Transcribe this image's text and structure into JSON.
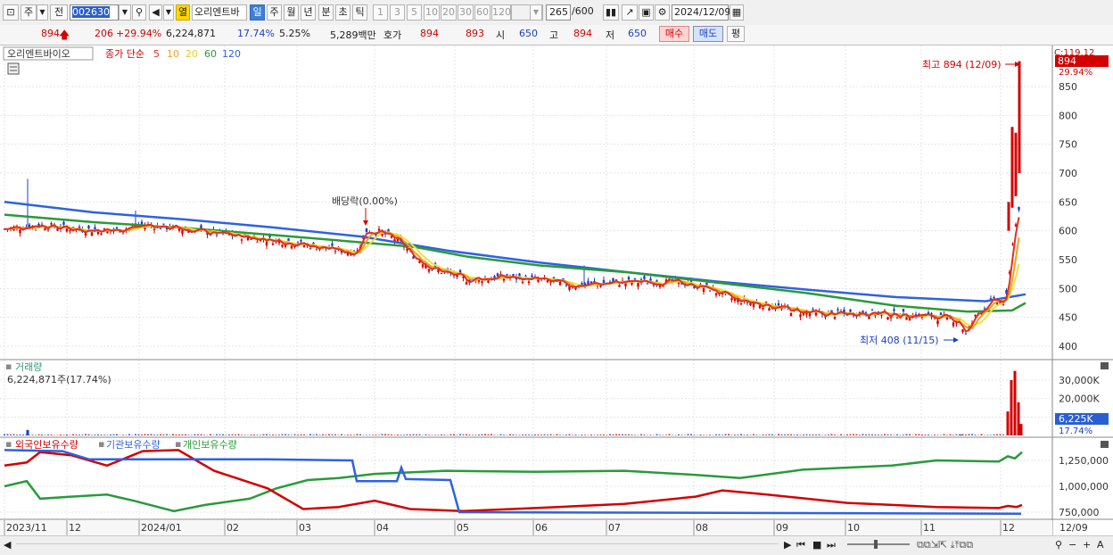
{
  "toolbar": {
    "type": "주",
    "prefix": "전",
    "code": "002630",
    "speaker_icon": "speaker-icon",
    "group_btn": "열",
    "name": "오리엔트바",
    "periods": [
      "일",
      "주",
      "월",
      "년",
      "분",
      "초",
      "틱"
    ],
    "active_period": "일",
    "minute_nums": [
      "1",
      "3",
      "5",
      "10",
      "20",
      "30",
      "60",
      "120"
    ],
    "count": "265",
    "count_total": "/600",
    "date": "2024/12/09"
  },
  "info": {
    "price": "894",
    "change": "206",
    "change_pct": "+29.94%",
    "volume": "6,224,871",
    "vol_pct": "17.74%",
    "turnover": "5.25%",
    "amount": "5,289백만",
    "quote_label": "호가",
    "ask": "894",
    "bid": "893",
    "open_label": "시",
    "open": "650",
    "high_label": "고",
    "high": "894",
    "low_label": "저",
    "low": "650",
    "buy": "매수",
    "sell": "매도",
    "eval": "평"
  },
  "price_pane": {
    "stock_label": "오리엔트바이오",
    "ma_label": "종가 단순",
    "ma_periods": [
      "5",
      "10",
      "20",
      "60",
      "120"
    ],
    "top_right": "C:119.12",
    "last_price": "894",
    "last_pct": "29.94%",
    "high_annot": "최고 894 (12/09)",
    "low_annot": "최저 408 (11/15)",
    "div_annot": "배당락(0.00%)",
    "y_ticks": [
      "850",
      "800",
      "750",
      "700",
      "650",
      "600",
      "550",
      "500",
      "450",
      "400"
    ]
  },
  "volume_pane": {
    "title": "거래량",
    "subtitle": "6,224,871주(17.74%)",
    "y_ticks": [
      "30,000K",
      "20,000K",
      "10,000K"
    ],
    "last": "6,225K",
    "last_pct": "17.74%"
  },
  "holding_pane": {
    "legend": [
      "외국인보유수량",
      "기관보유수량",
      "개인보유수량"
    ],
    "y_ticks": [
      "1,250,000",
      "1,000,000",
      "750,000"
    ]
  },
  "x_axis": {
    "labels": [
      "2023/11",
      "12",
      "2024/01",
      "02",
      "03",
      "04",
      "05",
      "06",
      "07",
      "08",
      "09",
      "10",
      "11",
      "12"
    ],
    "end_label": "12/09"
  },
  "colors": {
    "up": "#d40000",
    "down": "#1d3fc0",
    "ma5": "#e03020",
    "ma10": "#f0a020",
    "ma20": "#f0e040",
    "ma60": "#2a9a3a",
    "ma120": "#2e62e0"
  },
  "chart_data": {
    "type": "candlestick",
    "title": "오리엔트바이오",
    "x": [
      "2023/11",
      "12",
      "2024/01",
      "02",
      "03",
      "04",
      "05",
      "06",
      "07",
      "08",
      "09",
      "10",
      "11",
      "12"
    ],
    "close_path": [
      [
        0,
        603
      ],
      [
        40,
        610
      ],
      [
        80,
        603
      ],
      [
        120,
        600
      ],
      [
        160,
        610
      ],
      [
        200,
        603
      ],
      [
        240,
        595
      ],
      [
        280,
        588
      ],
      [
        320,
        580
      ],
      [
        360,
        570
      ],
      [
        395,
        562
      ],
      [
        405,
        600
      ],
      [
        420,
        598
      ],
      [
        440,
        585
      ],
      [
        460,
        555
      ],
      [
        480,
        535
      ],
      [
        520,
        515
      ],
      [
        560,
        520
      ],
      [
        600,
        515
      ],
      [
        640,
        505
      ],
      [
        680,
        510
      ],
      [
        720,
        512
      ],
      [
        760,
        510
      ],
      [
        790,
        500
      ],
      [
        820,
        480
      ],
      [
        860,
        470
      ],
      [
        890,
        460
      ],
      [
        920,
        455
      ],
      [
        960,
        458
      ],
      [
        1000,
        455
      ],
      [
        1040,
        452
      ],
      [
        1070,
        445
      ],
      [
        1078,
        420
      ],
      [
        1090,
        455
      ],
      [
        1105,
        475
      ],
      [
        1115,
        480
      ],
      [
        1125,
        470
      ],
      [
        1130,
        590
      ],
      [
        1136,
        620
      ],
      [
        1140,
        700
      ],
      [
        1145,
        894
      ]
    ],
    "ma120": [
      [
        0,
        650
      ],
      [
        100,
        632
      ],
      [
        200,
        620
      ],
      [
        300,
        606
      ],
      [
        400,
        590
      ],
      [
        500,
        565
      ],
      [
        600,
        545
      ],
      [
        700,
        528
      ],
      [
        800,
        512
      ],
      [
        900,
        498
      ],
      [
        1000,
        485
      ],
      [
        1100,
        478
      ],
      [
        1145,
        490
      ]
    ],
    "ma60": [
      [
        0,
        628
      ],
      [
        100,
        615
      ],
      [
        200,
        605
      ],
      [
        300,
        593
      ],
      [
        400,
        580
      ],
      [
        460,
        572
      ],
      [
        520,
        555
      ],
      [
        600,
        540
      ],
      [
        700,
        528
      ],
      [
        800,
        510
      ],
      [
        900,
        492
      ],
      [
        1000,
        470
      ],
      [
        1080,
        460
      ],
      [
        1130,
        462
      ],
      [
        1145,
        475
      ]
    ]
  }
}
